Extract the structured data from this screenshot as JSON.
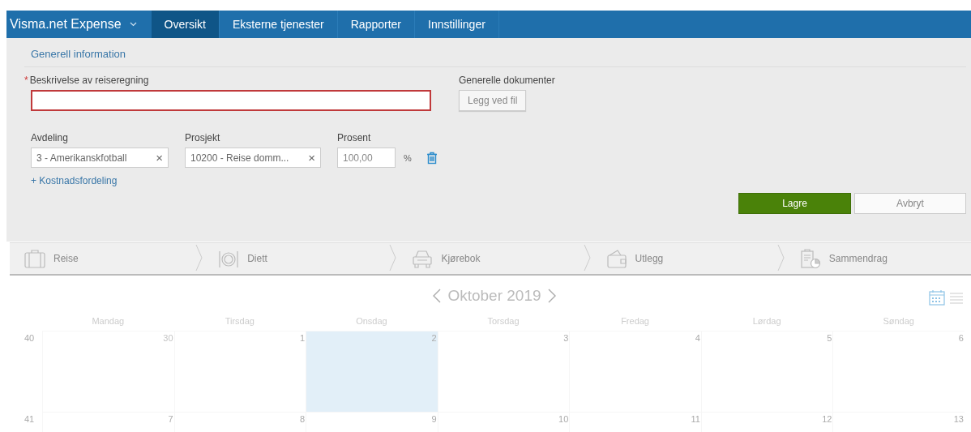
{
  "nav": {
    "brand": "Visma.net Expense",
    "tabs": [
      {
        "label": "Oversikt",
        "selected": true
      },
      {
        "label": "Eksterne tjenester",
        "selected": false
      },
      {
        "label": "Rapporter",
        "selected": false
      },
      {
        "label": "Innstillinger",
        "selected": false
      }
    ]
  },
  "section_title": "Generell information",
  "form": {
    "description": {
      "label": "Beskrivelse av reiseregning",
      "required_mark": "*",
      "invalid": true
    },
    "documents": {
      "label": "Generelle dokumenter",
      "button": "Legg ved fil"
    },
    "allocation": [
      {
        "kind": "select",
        "label": "Avdeling",
        "value": "3 - Amerikanskfotball",
        "clear": "×"
      },
      {
        "kind": "select",
        "label": "Prosjekt",
        "value": "10200 - Reise domm...",
        "clear": "×"
      },
      {
        "kind": "percent",
        "label": "Prosent",
        "value": "100,00",
        "unit": "%"
      }
    ],
    "add_link": "+ Kostnadsfordeling",
    "buttons": [
      {
        "label": "Lagre",
        "kind": "primary"
      },
      {
        "label": "Avbryt",
        "kind": "secondary"
      }
    ]
  },
  "steps": [
    {
      "label": "Reise",
      "kind": "suitcase"
    },
    {
      "label": "Diett",
      "kind": "plate"
    },
    {
      "label": "Kjørebok",
      "kind": "car"
    },
    {
      "label": "Utlegg",
      "kind": "wallet"
    },
    {
      "label": "Sammendrag",
      "kind": "clipboard"
    }
  ],
  "calendar": {
    "month": "Oktober 2019",
    "views": [
      {
        "kind": "calendar",
        "selected": true
      },
      {
        "kind": "list",
        "selected": false
      }
    ],
    "weekdays": [
      "Mandag",
      "Tirsdag",
      "Onsdag",
      "Torsdag",
      "Fredag",
      "Lørdag",
      "Søndag"
    ],
    "weeks": [
      {
        "number": "40",
        "days": [
          {
            "label": "30",
            "outside": true,
            "selected": false
          },
          {
            "label": "1",
            "outside": false,
            "selected": false
          },
          {
            "label": "2",
            "outside": false,
            "selected": true
          },
          {
            "label": "3",
            "outside": false,
            "selected": false
          },
          {
            "label": "4",
            "outside": false,
            "selected": false
          },
          {
            "label": "5",
            "outside": false,
            "selected": false
          },
          {
            "label": "6",
            "outside": false,
            "selected": false
          }
        ]
      },
      {
        "number": "41",
        "days": [
          {
            "label": "7",
            "outside": false,
            "selected": false
          },
          {
            "label": "8",
            "outside": false,
            "selected": false
          },
          {
            "label": "9",
            "outside": false,
            "selected": false
          },
          {
            "label": "10",
            "outside": false,
            "selected": false
          },
          {
            "label": "11",
            "outside": false,
            "selected": false
          },
          {
            "label": "12",
            "outside": false,
            "selected": false
          },
          {
            "label": "13",
            "outside": false,
            "selected": false
          }
        ]
      }
    ]
  }
}
